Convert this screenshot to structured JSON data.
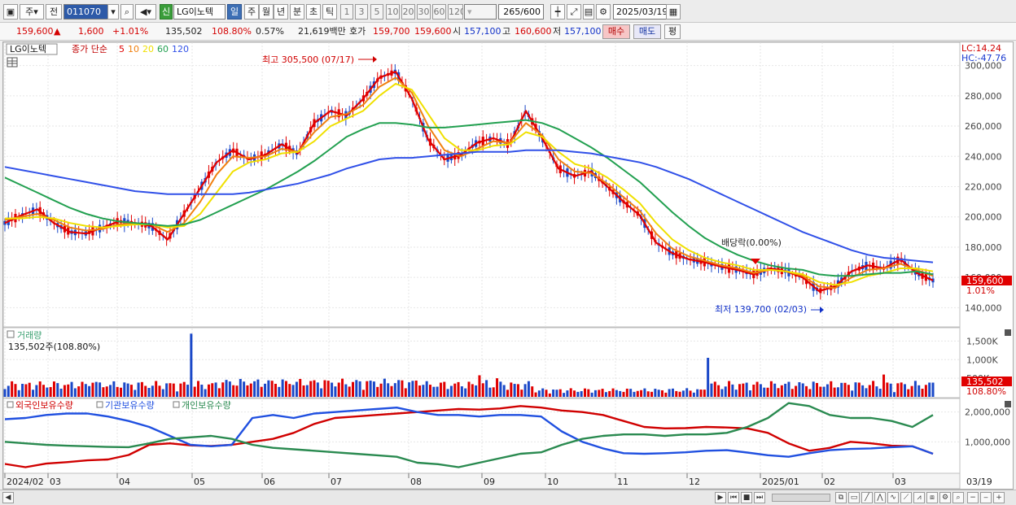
{
  "toolbar": {
    "market_label": "주",
    "prev_label": "전",
    "code": "011070",
    "new_badge": "신",
    "stock_name": "LG이노텍",
    "periods": [
      "일",
      "주",
      "월",
      "년",
      "분",
      "초",
      "틱"
    ],
    "active_period": "일",
    "intervals": [
      "1",
      "3",
      "5",
      "10",
      "20",
      "30",
      "60",
      "120"
    ],
    "count_value": "265",
    "count_max": "/600",
    "date": "2025/03/19"
  },
  "quote": {
    "price": "159,600",
    "change_arrow": "▲",
    "change": "1,600",
    "change_pct": "+1.01%",
    "volume": "135,502",
    "volume_ratio": "108.80%",
    "turnover": "0.57%",
    "amount": "21,619백만",
    "bid_label": "호가",
    "ask_price": "159,700",
    "bid_price": "159,600",
    "open_label": "시",
    "open": "157,100",
    "high_label": "고",
    "high": "160,600",
    "low_label": "저",
    "low": "157,100",
    "buy_label": "매수",
    "sell_label": "매도",
    "avg_label": "평"
  },
  "price_panel": {
    "stock_tag": "LG이노텍",
    "legend_prefix": "종가 단순",
    "ma": [
      {
        "period": "5",
        "color": "#e00000"
      },
      {
        "period": "10",
        "color": "#f08010"
      },
      {
        "period": "20",
        "color": "#f0e000"
      },
      {
        "period": "60",
        "color": "#22a050"
      },
      {
        "period": "120",
        "color": "#3050e8"
      }
    ],
    "lc": "LC:14.24",
    "hc": "HC:-47.76",
    "high_annot": "최고 305,500 (07/17)",
    "low_annot": "최저 139,700 (02/03)",
    "dividend_annot": "배당락(0.00%)",
    "current_price": "159,600",
    "current_pct": "1.01%",
    "y_ticks": [
      "300,000",
      "280,000",
      "260,000",
      "240,000",
      "220,000",
      "200,000",
      "180,000",
      "160,000",
      "140,000"
    ]
  },
  "volume_panel": {
    "title": "거래량",
    "info": "135,502주(108.80%)",
    "y_ticks": [
      "1,500K",
      "1,000K",
      "500K"
    ],
    "current": "135,502",
    "current_pct": "108.80%"
  },
  "holding_panel": {
    "legend": [
      {
        "name": "외국인보유수량",
        "color": "#d00000"
      },
      {
        "name": "기관보유수량",
        "color": "#2050e0"
      },
      {
        "name": "개인보유수량",
        "color": "#2a8a50"
      }
    ],
    "y_ticks": [
      "2,000,000",
      "1,000,000"
    ]
  },
  "x_axis": {
    "labels": [
      "2024/02",
      "03",
      "04",
      "05",
      "06",
      "07",
      "08",
      "09",
      "10",
      "11",
      "12",
      "2025/01",
      "02",
      "03"
    ],
    "right_label": "03/19"
  },
  "chart_data": [
    {
      "type": "line",
      "title": "",
      "ylim": [
        130000,
        310000
      ],
      "series": [
        {
          "name": "5",
          "values": [
            196000,
            201000,
            205000,
            196000,
            190000,
            189000,
            193000,
            197000,
            196000,
            194000,
            185000,
            202000,
            219000,
            236000,
            244000,
            238000,
            241000,
            248000,
            242000,
            262000,
            270000,
            267000,
            278000,
            292000,
            296000,
            278000,
            251000,
            238000,
            241000,
            249000,
            252000,
            248000,
            270000,
            252000,
            232000,
            227000,
            230000,
            220000,
            210000,
            201000,
            183000,
            176000,
            172000,
            170000,
            167000,
            165000,
            162000,
            166000,
            164000,
            160000,
            151000,
            154000,
            164000,
            168000,
            166000,
            172000,
            163000,
            158000
          ]
        },
        {
          "name": "10",
          "values": [
            198000,
            200000,
            202000,
            198000,
            193000,
            191000,
            192000,
            195000,
            196000,
            195000,
            190000,
            196000,
            210000,
            228000,
            240000,
            239000,
            240000,
            245000,
            243000,
            256000,
            266000,
            268000,
            274000,
            286000,
            292000,
            282000,
            260000,
            244000,
            240000,
            245000,
            250000,
            249000,
            262000,
            254000,
            238000,
            230000,
            229000,
            222000,
            213000,
            204000,
            189000,
            179000,
            174000,
            171000,
            168000,
            166000,
            163000,
            165000,
            164000,
            161000,
            154000,
            153000,
            160000,
            165000,
            166000,
            169000,
            165000,
            161000
          ]
        },
        {
          "name": "20",
          "values": [
            199000,
            199000,
            200000,
            199000,
            196000,
            194000,
            193000,
            194000,
            195000,
            195000,
            193000,
            194000,
            202000,
            216000,
            230000,
            236000,
            238000,
            242000,
            243000,
            250000,
            260000,
            265000,
            270000,
            280000,
            288000,
            284000,
            268000,
            252000,
            244000,
            244000,
            247000,
            248000,
            256000,
            253000,
            243000,
            235000,
            232000,
            226000,
            218000,
            209000,
            196000,
            185000,
            178000,
            173000,
            170000,
            168000,
            165000,
            165000,
            164000,
            162000,
            157000,
            155000,
            157000,
            161000,
            163000,
            166000,
            166000,
            164000
          ]
        },
        {
          "name": "60",
          "values": [
            226000,
            221000,
            216000,
            211000,
            206000,
            202000,
            199000,
            197000,
            196000,
            195000,
            194000,
            195000,
            198000,
            203000,
            208000,
            213000,
            218000,
            224000,
            230000,
            237000,
            245000,
            253000,
            258000,
            262000,
            262000,
            261000,
            259000,
            259000,
            260000,
            261000,
            262000,
            263000,
            264000,
            262000,
            258000,
            252000,
            246000,
            239000,
            231000,
            223000,
            213000,
            203000,
            194000,
            186000,
            180000,
            175000,
            171000,
            168000,
            166000,
            165000,
            162000,
            161000,
            161000,
            162000,
            163000,
            163000,
            164000,
            162000
          ]
        },
        {
          "name": "120",
          "values": [
            233000,
            231000,
            229000,
            227000,
            225000,
            223000,
            221000,
            219000,
            217000,
            216000,
            215000,
            215000,
            215000,
            215000,
            215000,
            216000,
            218000,
            220000,
            222000,
            225000,
            228000,
            232000,
            235000,
            238000,
            239000,
            239000,
            240000,
            241000,
            242000,
            243000,
            243000,
            243000,
            244000,
            244000,
            244000,
            243000,
            242000,
            240000,
            238000,
            236000,
            233000,
            229000,
            225000,
            220000,
            215000,
            210000,
            205000,
            200000,
            195000,
            190000,
            186000,
            182000,
            178000,
            175000,
            173000,
            172000,
            171000,
            170000
          ]
        }
      ]
    },
    {
      "type": "line",
      "title": "",
      "series": [
        {
          "name": "외국인보유수량",
          "values": [
            260000,
            150000,
            270000,
            320000,
            380000,
            410000,
            560000,
            900000,
            950000,
            880000,
            860000,
            900000,
            1000000,
            1100000,
            1300000,
            1600000,
            1800000,
            1850000,
            1900000,
            1950000,
            2000000,
            2050000,
            2100000,
            2080000,
            2120000,
            2200000,
            2150000,
            2050000,
            2000000,
            1900000,
            1700000,
            1500000,
            1450000,
            1460000,
            1500000,
            1480000,
            1450000,
            1300000,
            950000,
            700000,
            800000,
            1000000,
            950000,
            870000,
            850000,
            600000
          ]
        },
        {
          "name": "기관보유수량",
          "values": [
            1760000,
            1800000,
            1900000,
            1950000,
            1950000,
            1850000,
            1700000,
            1500000,
            1200000,
            900000,
            850000,
            900000,
            1800000,
            1900000,
            1800000,
            1950000,
            2000000,
            2050000,
            2100000,
            2150000,
            2000000,
            1900000,
            1900000,
            1850000,
            1900000,
            1900000,
            1850000,
            1350000,
            1000000,
            780000,
            620000,
            600000,
            620000,
            650000,
            700000,
            720000,
            640000,
            550000,
            500000,
            620000,
            720000,
            760000,
            780000,
            820000,
            850000,
            600000
          ]
        },
        {
          "name": "개인보유수량",
          "values": [
            1000000,
            950000,
            900000,
            870000,
            850000,
            830000,
            820000,
            950000,
            1100000,
            1150000,
            1200000,
            1100000,
            900000,
            800000,
            750000,
            700000,
            650000,
            600000,
            550000,
            500000,
            300000,
            250000,
            150000,
            300000,
            450000,
            600000,
            650000,
            900000,
            1100000,
            1200000,
            1250000,
            1250000,
            1200000,
            1250000,
            1250000,
            1300000,
            1500000,
            1800000,
            2300000,
            2200000,
            1900000,
            1800000,
            1800000,
            1700000,
            1500000,
            1900000
          ]
        }
      ]
    }
  ]
}
